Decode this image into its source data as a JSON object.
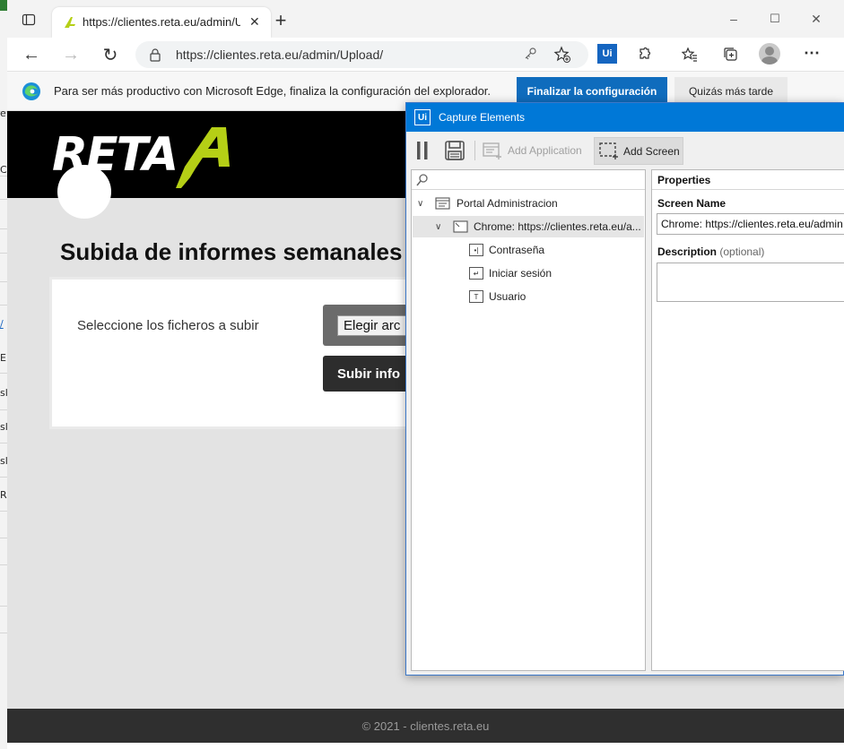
{
  "browser": {
    "tab_title": "https://clientes.reta.eu/admin/Upload/",
    "url": "https://clientes.reta.eu/admin/Upload/",
    "new_tab_symbol": "+",
    "window_controls": [
      "–",
      "☐",
      "✕"
    ]
  },
  "infobar": {
    "message": "Para ser más productivo con Microsoft Edge, finaliza la configuración del explorador.",
    "finish_label": "Finalizar la configuración",
    "later_label": "Quizás más tarde"
  },
  "page": {
    "logo_text": "RETA",
    "title": "Subida de informes semanales",
    "select_files_label": "Seleccione los ficheros a subir",
    "choose_file_label": "Elegir arc",
    "upload_label": "Subir info",
    "footer": "© 2021 - clientes.reta.eu"
  },
  "background_window": {
    "fragments": [
      "e",
      "C",
      "/",
      "ER",
      "sl",
      "sl",
      "sl",
      "R"
    ]
  },
  "capture": {
    "logo": "Ui",
    "title": "Capture Elements",
    "toolbar": {
      "add_application": "Add Application",
      "add_screen": "Add Screen"
    },
    "tree": {
      "root": "Portal Administracion",
      "screen": "Chrome: https://clientes.reta.eu/a...",
      "elements": [
        {
          "label": "Contraseña",
          "glyph": "•|"
        },
        {
          "label": "Iniciar sesión",
          "glyph": "↵"
        },
        {
          "label": "Usuario",
          "glyph": "T"
        }
      ]
    },
    "properties": {
      "heading": "Properties",
      "screen_name_label": "Screen Name",
      "screen_name_value": "Chrome: https://clientes.reta.eu/admin",
      "description_label": "Description",
      "description_optional": "(optional)"
    }
  },
  "colors": {
    "edge_blue": "#0f6cbd",
    "capture_title_blue": "#0078d7",
    "reta_green": "#b5cf16",
    "header_black": "#000000"
  }
}
